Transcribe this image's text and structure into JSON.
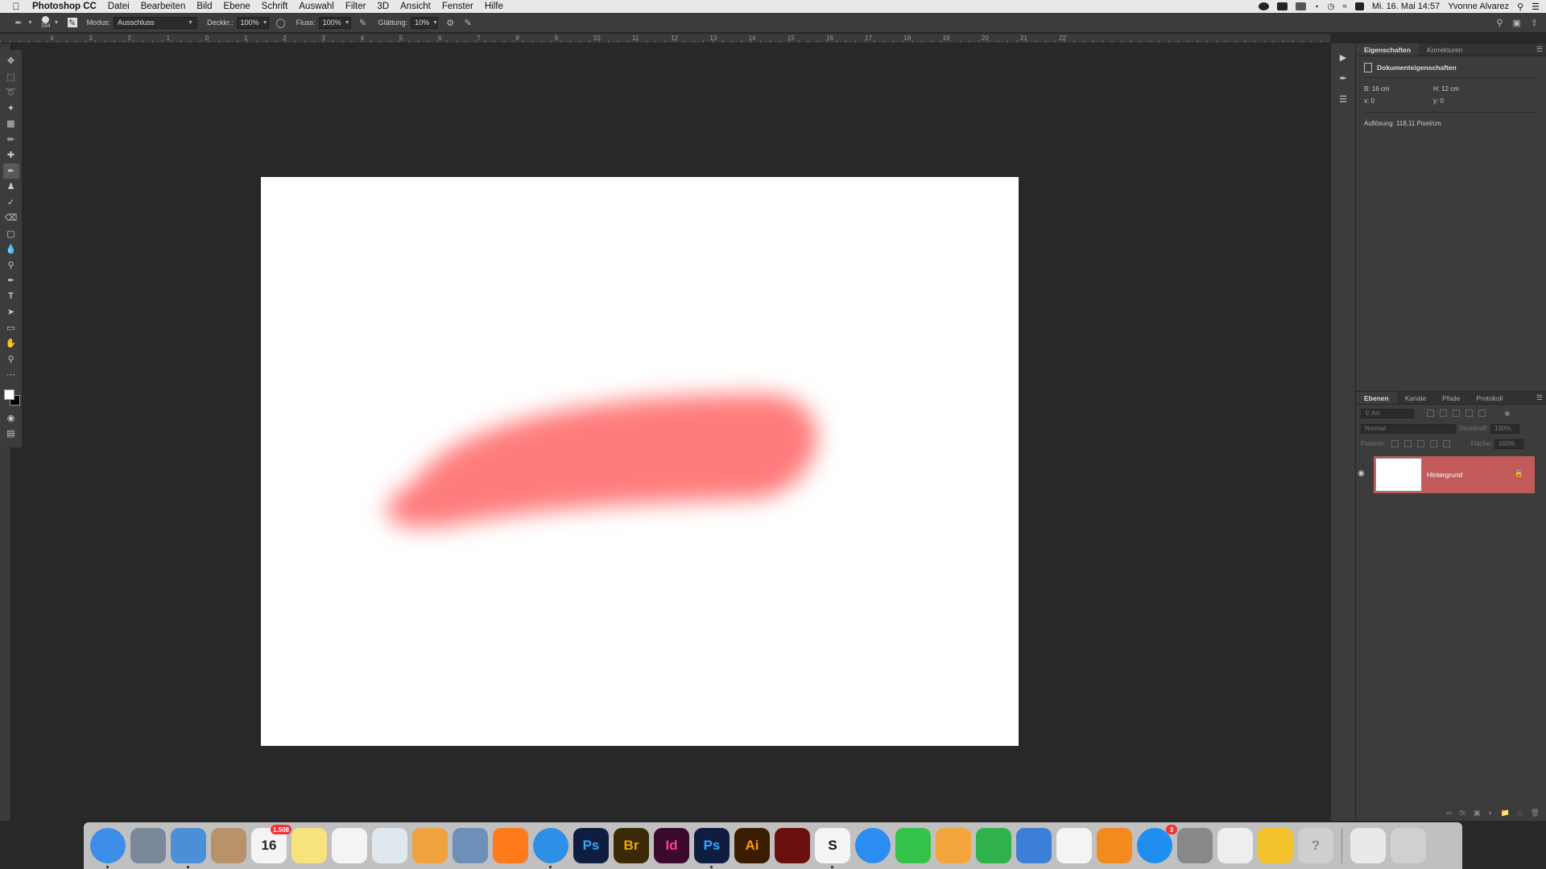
{
  "colors": {
    "accent_layer": "#c25a5a",
    "brush_stroke": "#ff7b7b",
    "panel_bg": "#3c3c3c",
    "workspace_bg": "#282828"
  },
  "menubar": {
    "app_name": "Photoshop CC",
    "menus": [
      "Datei",
      "Bearbeiten",
      "Bild",
      "Ebene",
      "Schrift",
      "Auswahl",
      "Filter",
      "3D",
      "Ansicht",
      "Fenster",
      "Hilfe"
    ],
    "clock": "Mi. 16. Mai 14:57",
    "user": "Yvonne Alvarez",
    "status_icons": [
      "creative-cloud-icon",
      "display-icon",
      "airplay-icon",
      "bluetooth-icon",
      "time-machine-icon",
      "wifi-icon",
      "input-source-icon"
    ]
  },
  "options_bar": {
    "brush_size": "334",
    "mode_label": "Modus:",
    "mode_value": "Ausschluss",
    "opacity_label": "Deckkr.:",
    "opacity_value": "100%",
    "flow_label": "Fluss:",
    "flow_value": "100%",
    "smoothing_label": "Glättung:",
    "smoothing_value": "10%"
  },
  "ruler": {
    "labels": [
      "4",
      "3",
      "2",
      "1",
      "0",
      "1",
      "2",
      "3",
      "4",
      "5",
      "6",
      "7",
      "8",
      "9",
      "10",
      "11",
      "12",
      "13",
      "14",
      "15",
      "16",
      "17",
      "18",
      "19",
      "20",
      "21",
      "22"
    ]
  },
  "tools": [
    "move-tool",
    "marquee-tool",
    "lasso-tool",
    "magic-wand-tool",
    "crop-tool",
    "eyedropper-tool",
    "healing-brush-tool",
    "brush-tool",
    "clone-stamp-tool",
    "history-brush-tool",
    "eraser-tool",
    "gradient-tool",
    "blur-tool",
    "dodge-tool",
    "pen-tool",
    "type-tool",
    "path-selection-tool",
    "rectangle-tool",
    "hand-tool",
    "zoom-tool",
    "more-tools"
  ],
  "active_tool": "brush-tool",
  "properties_panel": {
    "tabs": [
      "Eigenschaften",
      "Korrekturen"
    ],
    "active_tab": "Eigenschaften",
    "header": "Dokumenteigenschaften",
    "width": "B: 16 cm",
    "height": "H: 12 cm",
    "x": "x: 0",
    "y": "y: 0",
    "resolution": "Auflösung: 118,11 Pixel/cm"
  },
  "layers_panel": {
    "tabs": [
      "Ebenen",
      "Kanäle",
      "Pfade",
      "Protokoll"
    ],
    "active_tab": "Ebenen",
    "filter_placeholder": "Art",
    "blend_mode": "Normal",
    "opacity_label": "Deckkraft:",
    "opacity_value": "100%",
    "lock_label": "Fixieren:",
    "fill_label": "Fläche:",
    "fill_value": "100%",
    "layers": [
      {
        "name": "Hintergrund",
        "locked": true,
        "visible": true,
        "selected": true
      }
    ]
  },
  "dock": {
    "items": [
      {
        "name": "finder",
        "label": "",
        "color": "#3d8ee8",
        "running": true
      },
      {
        "name": "launchpad",
        "label": "",
        "color": "#7a8899"
      },
      {
        "name": "mail-app",
        "label": "",
        "color": "#4a8fd8",
        "running": true
      },
      {
        "name": "contacts",
        "label": "",
        "color": "#b8926a"
      },
      {
        "name": "calendar",
        "label": "16",
        "color": "#f4f4f4",
        "text_color": "#222",
        "badge": "1.508"
      },
      {
        "name": "notes",
        "label": "",
        "color": "#f7e27c"
      },
      {
        "name": "reminders",
        "label": "",
        "color": "#f4f4f4"
      },
      {
        "name": "preview",
        "label": "",
        "color": "#dfe8ef"
      },
      {
        "name": "photos",
        "label": "",
        "color": "#f1a23f"
      },
      {
        "name": "image-capture",
        "label": "",
        "color": "#6d8fb8"
      },
      {
        "name": "firefox",
        "label": "",
        "color": "#ff7a1a"
      },
      {
        "name": "safari",
        "label": "",
        "color": "#2e8fe6",
        "running": true
      },
      {
        "name": "photoshop",
        "label": "Ps",
        "color": "#0f1e40",
        "text_color": "#31a8ff"
      },
      {
        "name": "bridge",
        "label": "Br",
        "color": "#3a2a08",
        "text_color": "#f0a800"
      },
      {
        "name": "indesign",
        "label": "Id",
        "color": "#3b0a2a",
        "text_color": "#ff3d9a"
      },
      {
        "name": "photoshop-running",
        "label": "Ps",
        "color": "#0f1e40",
        "text_color": "#31a8ff",
        "running": true
      },
      {
        "name": "illustrator",
        "label": "Ai",
        "color": "#3a1d00",
        "text_color": "#ff9a00"
      },
      {
        "name": "acrobat",
        "label": "",
        "color": "#6a0f0f"
      },
      {
        "name": "sketch-like-app",
        "label": "S",
        "color": "#f4f4f4",
        "text_color": "#111",
        "running": true
      },
      {
        "name": "messages",
        "label": "",
        "color": "#2b8df2"
      },
      {
        "name": "facetime",
        "label": "",
        "color": "#33c24a"
      },
      {
        "name": "pages",
        "label": "",
        "color": "#f3a53b"
      },
      {
        "name": "numbers",
        "label": "",
        "color": "#2fb24a"
      },
      {
        "name": "keynote",
        "label": "",
        "color": "#3b7fd8"
      },
      {
        "name": "itunes",
        "label": "",
        "color": "#f4f4f4"
      },
      {
        "name": "ibooks",
        "label": "",
        "color": "#f28a1e"
      },
      {
        "name": "app-store",
        "label": "",
        "color": "#1e8ff0",
        "badge": "3"
      },
      {
        "name": "system-preferences",
        "label": "",
        "color": "#888888"
      },
      {
        "name": "accessibility-app",
        "label": "",
        "color": "#eeeeee"
      },
      {
        "name": "cyberduck",
        "label": "",
        "color": "#f3c22a"
      },
      {
        "name": "help",
        "label": "?",
        "color": "#cfcfcf",
        "text_color": "#888"
      },
      {
        "name": "documents-stack",
        "label": "",
        "color": "#e9e9e9"
      },
      {
        "name": "trash",
        "label": "",
        "color": "#d0d0d0"
      }
    ]
  }
}
